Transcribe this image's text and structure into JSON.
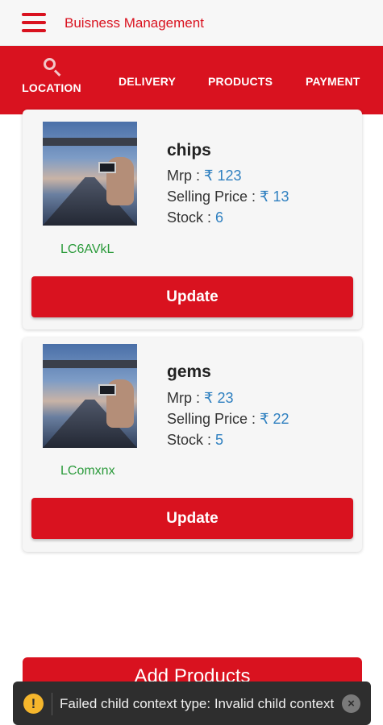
{
  "app": {
    "title": "Buisness Management"
  },
  "tabs": [
    {
      "label": "LOCATION",
      "icon": "search-icon"
    },
    {
      "label": "DELIVERY"
    },
    {
      "label": "PRODUCTS"
    },
    {
      "label": "PAYMENT"
    }
  ],
  "products": [
    {
      "name": "chips",
      "mrp_label": "Mrp :",
      "mrp": "₹ 123",
      "selling_label": "Selling Price :",
      "selling": "₹ 13",
      "stock_label": "Stock :",
      "stock": "6",
      "code": "LC6AVkL",
      "update_label": "Update"
    },
    {
      "name": "gems",
      "mrp_label": "Mrp :",
      "mrp": "₹ 23",
      "selling_label": "Selling Price :",
      "selling": "₹ 22",
      "stock_label": "Stock :",
      "stock": "5",
      "code": "LComxnx",
      "update_label": "Update"
    }
  ],
  "add_products_label": "Add Products",
  "toast": {
    "message": "Failed child context type: Invalid child context",
    "icon": "warning-icon",
    "close_icon": "close-icon"
  },
  "colors": {
    "accent": "#d9121f",
    "value": "#2f80c0",
    "code": "#2a9a3a"
  }
}
